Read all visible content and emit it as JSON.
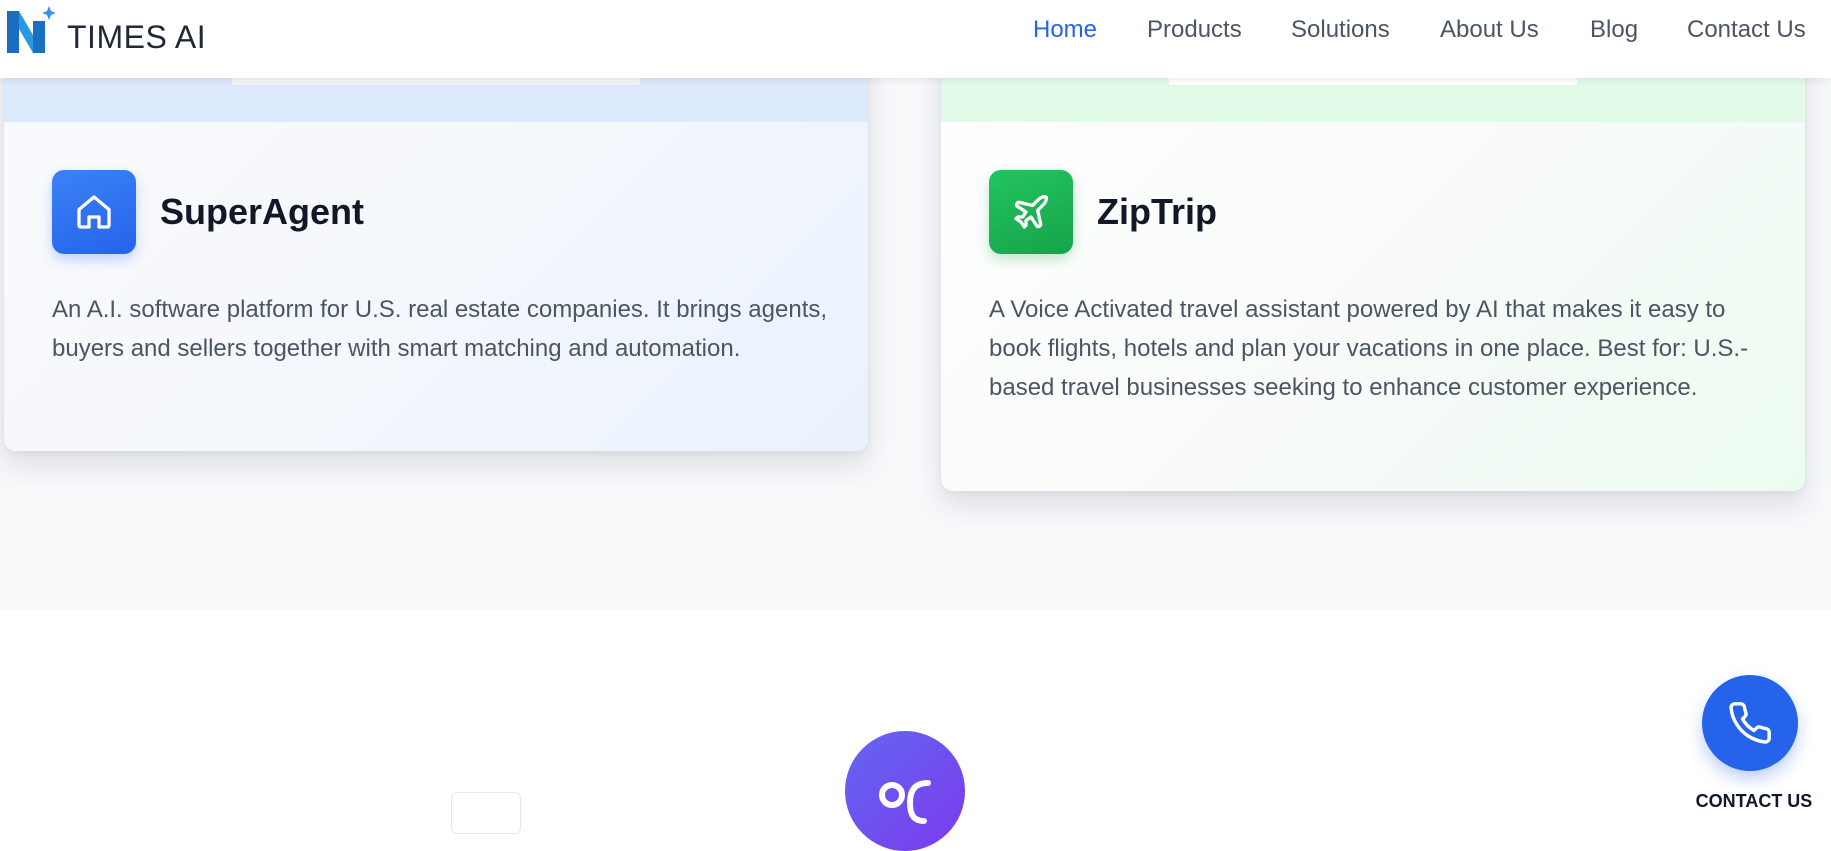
{
  "brand": {
    "name": "TIMES AI",
    "colors": {
      "accent": "#2563eb",
      "green": "#16a34a",
      "purple": "#7c3aed"
    }
  },
  "nav": {
    "items": [
      {
        "label": "Home",
        "active": true
      },
      {
        "label": "Products",
        "active": false
      },
      {
        "label": "Solutions",
        "active": false
      },
      {
        "label": "About Us",
        "active": false
      },
      {
        "label": "Blog",
        "active": false
      },
      {
        "label": "Contact Us",
        "active": false
      }
    ]
  },
  "products": [
    {
      "name": "SuperAgent",
      "icon": "house-icon",
      "description": "An A.I. software platform for U.S. real estate companies. It brings agents, buyers and sellers together with smart matching and automation."
    },
    {
      "name": "ZipTrip",
      "icon": "plane-icon",
      "description": "A Voice Activated travel assistant powered by AI that makes it easy to book flights, hotels and plan your vacations in one place. Best for: U.S.-based travel businesses seeking to enhance customer experience."
    }
  ],
  "contact_fab": {
    "icon": "phone-icon",
    "label": "CONTACT US"
  }
}
